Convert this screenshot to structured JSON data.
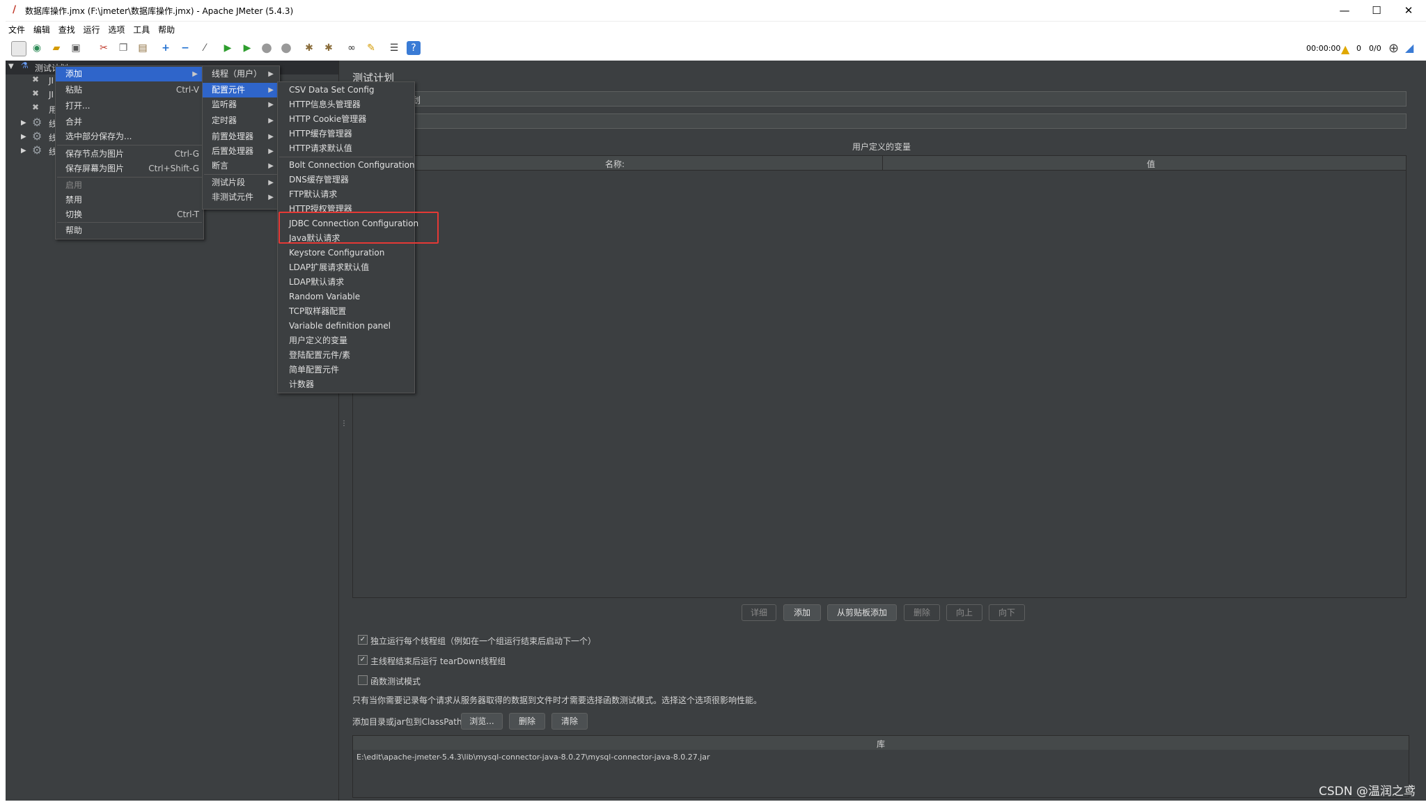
{
  "window": {
    "title": "数据库操作.jmx (F:\\jmeter\\数据库操作.jmx) - Apache JMeter (5.4.3)",
    "minimize": "—",
    "maximize": "☐",
    "close": "✕"
  },
  "menubar": [
    "文件",
    "编辑",
    "查找",
    "运行",
    "选项",
    "工具",
    "帮助"
  ],
  "toolbar_status": {
    "time": "00:00:00",
    "warnings": "0",
    "threads": "0/0"
  },
  "tree": {
    "root_label": "测试计划",
    "children": [
      "JI",
      "JI",
      "用",
      "线",
      "线",
      "线"
    ]
  },
  "context_menu": {
    "items": [
      {
        "label": "添加",
        "shortcut": ""
      },
      {
        "label": "粘贴",
        "shortcut": "Ctrl-V"
      },
      {
        "label": "打开...",
        "shortcut": ""
      },
      {
        "label": "合并",
        "shortcut": ""
      },
      {
        "label": "选中部分保存为...",
        "shortcut": ""
      },
      {
        "label": "保存节点为图片",
        "shortcut": "Ctrl-G"
      },
      {
        "label": "保存屏幕为图片",
        "shortcut": "Ctrl+Shift-G"
      },
      {
        "label": "启用",
        "shortcut": ""
      },
      {
        "label": "禁用",
        "shortcut": ""
      },
      {
        "label": "切换",
        "shortcut": "Ctrl-T"
      },
      {
        "label": "帮助",
        "shortcut": ""
      }
    ]
  },
  "add_submenu": {
    "items": [
      "线程（用户）",
      "配置元件",
      "监听器",
      "定时器",
      "前置处理器",
      "后置处理器",
      "断言",
      "测试片段",
      "非测试元件"
    ]
  },
  "config_submenu": {
    "items": [
      "CSV Data Set Config",
      "HTTP信息头管理器",
      "HTTP Cookie管理器",
      "HTTP缓存管理器",
      "HTTP请求默认值",
      "Bolt Connection Configuration",
      "DNS缓存管理器",
      "FTP默认请求",
      "HTTP授权管理器",
      "JDBC Connection Configuration",
      "Java默认请求",
      "Keystore Configuration",
      "LDAP扩展请求默认值",
      "LDAP默认请求",
      "Random Variable",
      "TCP取样器配置",
      "Variable definition panel",
      "用户定义的变量",
      "登陆配置元件/素",
      "简单配置元件",
      "计数器"
    ]
  },
  "panel": {
    "title": "测试计划",
    "name_field_partial": "划",
    "udv_title": "用户定义的变量",
    "col_name": "名称:",
    "col_value": "值",
    "buttons": [
      "详细",
      "添加",
      "从剪贴板添加",
      "删除",
      "向上",
      "向下"
    ],
    "checkbox1": "独立运行每个线程组（例如在一个组运行结束后启动下一个）",
    "checkbox2": "主线程结束后运行 tearDown线程组",
    "checkbox3": "函数测试模式",
    "note": "只有当你需要记录每个请求从服务器取得的数据到文件时才需要选择函数测试模式。选择这个选项很影响性能。",
    "classpath_label": "添加目录或jar包到ClassPath",
    "classpath_buttons": [
      "浏览...",
      "删除",
      "清除"
    ],
    "lib_header": "库",
    "lib_row": "E:\\edit\\apache-jmeter-5.4.3\\lib\\mysql-connector-java-8.0.27\\mysql-connector-java-8.0.27.jar"
  },
  "watermark": "CSDN @温润之鸢",
  "colors": {
    "bg": "#3c3f41",
    "highlight": "#2f65ca",
    "annotation": "#e53935"
  }
}
